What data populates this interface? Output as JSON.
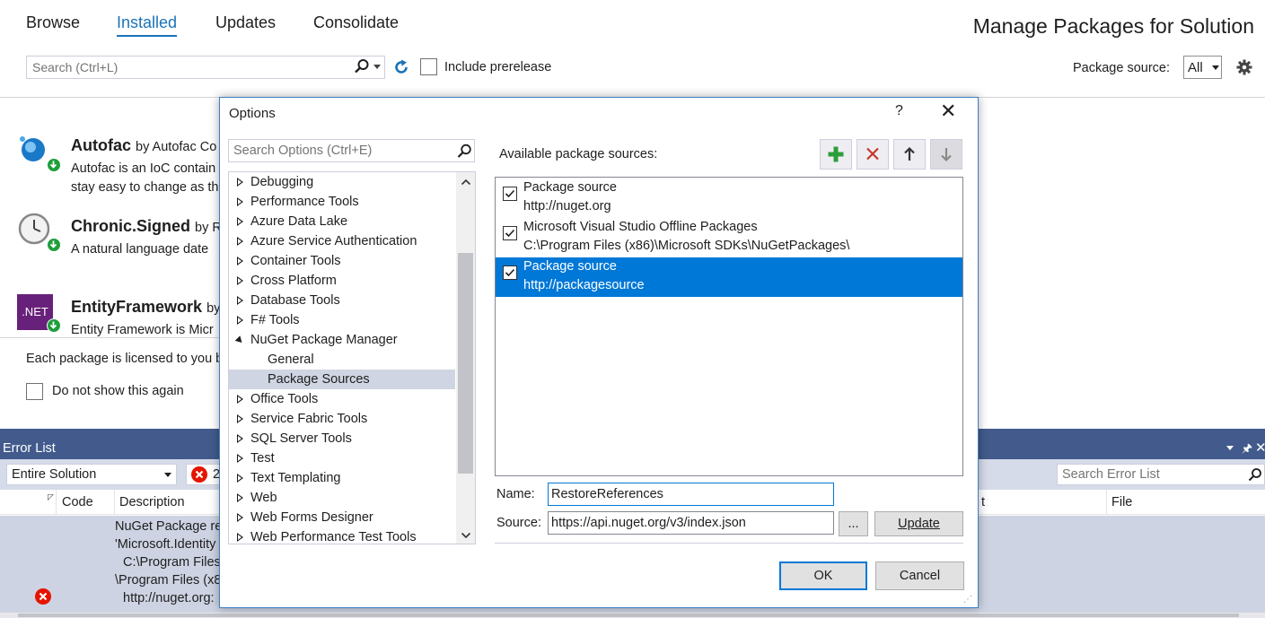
{
  "nuget": {
    "tabs": [
      "Browse",
      "Installed",
      "Updates",
      "Consolidate"
    ],
    "title": "Manage Packages for Solution",
    "search_placeholder": "Search (Ctrl+L)",
    "include_prerelease": "Include prerelease",
    "package_source_label": "Package source:",
    "package_source_value": "All",
    "packages": [
      {
        "name": "Autofac",
        "by": "by Autofac Co",
        "desc1": "Autofac is an IoC contain",
        "desc2": "stay easy to change as th"
      },
      {
        "name": "Chronic.Signed",
        "by": "by R",
        "desc1": "A natural language date"
      },
      {
        "name": "EntityFramework",
        "by": "by",
        "desc1": "Entity Framework is Micr",
        "icon_text": ".NET"
      }
    ],
    "license_text": "Each package is licensed to you b",
    "do_not_show": "Do not show this again"
  },
  "errors": {
    "title": "Error List",
    "scope": "Entire Solution",
    "error_count": "2",
    "search_placeholder": "Search Error List",
    "columns": {
      "code": "Code",
      "description": "Description",
      "project": "t",
      "file": "File"
    },
    "row_lines": [
      "NuGet Package re",
      "'Microsoft.Identity",
      "C:\\Program Files",
      "\\Program Files (x8",
      "http://nuget.org:"
    ]
  },
  "dialog": {
    "title": "Options",
    "help": "?",
    "search_placeholder": "Search Options (Ctrl+E)",
    "tree": [
      {
        "label": "Debugging",
        "type": "collapsed"
      },
      {
        "label": "Performance Tools",
        "type": "collapsed"
      },
      {
        "label": "Azure Data Lake",
        "type": "collapsed"
      },
      {
        "label": "Azure Service Authentication",
        "type": "collapsed"
      },
      {
        "label": "Container Tools",
        "type": "collapsed"
      },
      {
        "label": "Cross Platform",
        "type": "collapsed"
      },
      {
        "label": "Database Tools",
        "type": "collapsed"
      },
      {
        "label": "F# Tools",
        "type": "collapsed"
      },
      {
        "label": "NuGet Package Manager",
        "type": "expanded"
      },
      {
        "label": "General",
        "type": "child"
      },
      {
        "label": "Package Sources",
        "type": "child-selected"
      },
      {
        "label": "Office Tools",
        "type": "collapsed"
      },
      {
        "label": "Service Fabric Tools",
        "type": "collapsed"
      },
      {
        "label": "SQL Server Tools",
        "type": "collapsed"
      },
      {
        "label": "Test",
        "type": "collapsed"
      },
      {
        "label": "Text Templating",
        "type": "collapsed"
      },
      {
        "label": "Web",
        "type": "collapsed"
      },
      {
        "label": "Web Forms Designer",
        "type": "collapsed"
      },
      {
        "label": "Web Performance Test Tools",
        "type": "collapsed"
      }
    ],
    "available_label": "Available package sources:",
    "sources": [
      {
        "name": "Package source",
        "url": "http://nuget.org",
        "checked": true,
        "selected": false
      },
      {
        "name": "Microsoft Visual Studio Offline Packages",
        "url": "C:\\Program Files (x86)\\Microsoft SDKs\\NuGetPackages\\",
        "checked": true,
        "selected": false
      },
      {
        "name": "Package source",
        "url": "http://packagesource",
        "checked": true,
        "selected": true
      }
    ],
    "name_label": "Name:",
    "name_value": "RestoreReferences",
    "source_label": "Source:",
    "source_value": "https://api.nuget.org/v3/index.json",
    "browse_label": "...",
    "update_label": "Update",
    "ok_label": "OK",
    "cancel_label": "Cancel",
    "colors": {
      "accent": "#0078d7",
      "add": "#2e9e3a",
      "remove": "#c5352c",
      "error_panel": "#425b8c"
    }
  }
}
